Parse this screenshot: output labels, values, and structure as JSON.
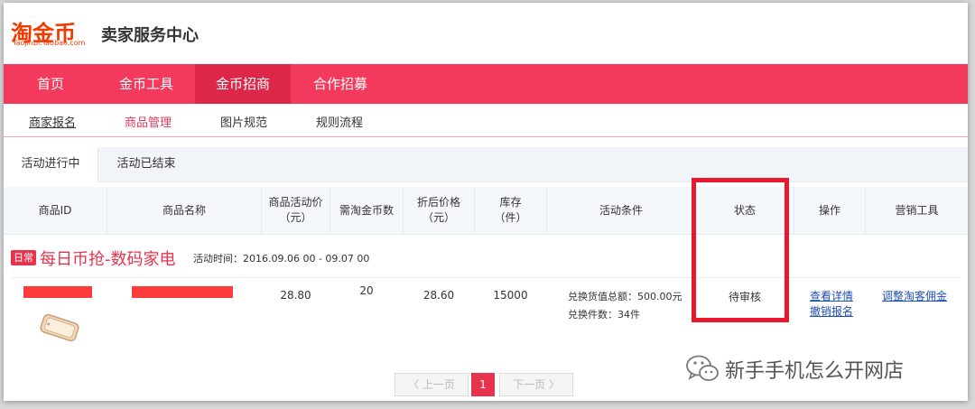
{
  "header": {
    "logo_text": "淘金币",
    "logo_sub": "Taojinbi.Taobao.com",
    "title": "卖家服务中心"
  },
  "nav": {
    "items": [
      {
        "label": "首页"
      },
      {
        "label": "金币工具"
      },
      {
        "label": "金币招商",
        "active": true
      },
      {
        "label": "合作招募"
      }
    ]
  },
  "subnav": {
    "items": [
      {
        "label": "商家报名",
        "active": true
      },
      {
        "label": "商品管理"
      },
      {
        "label": "图片规范"
      },
      {
        "label": "规则流程"
      }
    ]
  },
  "tabs": [
    {
      "label": "活动进行中",
      "active": true
    },
    {
      "label": "活动已结束"
    }
  ],
  "table": {
    "headers": {
      "id": "商品ID",
      "name": "商品名称",
      "price_l1": "商品活动价",
      "price_l2": "（元）",
      "coins": "需淘金币数",
      "discount_l1": "折后价格",
      "discount_l2": "（元）",
      "stock_l1": "库存",
      "stock_l2": "（件）",
      "condition": "活动条件",
      "status": "状态",
      "action": "操作",
      "marketing": "营销工具"
    },
    "group": {
      "badge": "日常",
      "title": "每日币抢-数码家电",
      "time": "活动时间：2016.09.06 00 - 09.07 00"
    },
    "row": {
      "price": "28.80",
      "coins": "20",
      "discount_price": "28.60",
      "stock": "15000",
      "condition_line1": "兑换货值总额：500.00元",
      "condition_line2": "兑换件数：34件",
      "status": "待审核",
      "action_view": "查看详情",
      "action_cancel": "撤销报名",
      "marketing_link": "调整淘客佣金"
    }
  },
  "pager": {
    "prev": "上一页",
    "current": "1",
    "next": "下一页"
  },
  "watermark": {
    "text": "新手手机怎么开网店"
  },
  "colors": {
    "brand": "#f43a5c",
    "brand_dark": "#dd2749",
    "highlight": "#e8192c",
    "link": "#1f4fb0"
  }
}
